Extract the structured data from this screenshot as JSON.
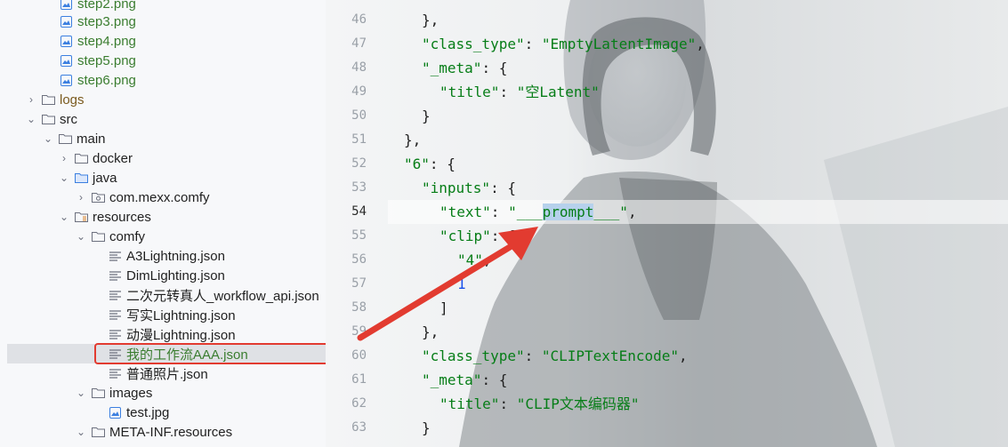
{
  "tree": {
    "rows": [
      {
        "label": "step2.png",
        "type": "image",
        "chev": "",
        "color": "green"
      },
      {
        "label": "step3.png",
        "type": "image",
        "chev": "",
        "color": "green"
      },
      {
        "label": "step4.png",
        "type": "image",
        "chev": "",
        "color": "green"
      },
      {
        "label": "step5.png",
        "type": "image",
        "chev": "",
        "color": "green"
      },
      {
        "label": "step6.png",
        "type": "image",
        "chev": "",
        "color": "green"
      },
      {
        "label": "logs",
        "type": "folder",
        "chev": "›",
        "color": "brown"
      },
      {
        "label": "src",
        "type": "folder",
        "chev": "⌄",
        "color": ""
      },
      {
        "label": "main",
        "type": "folder",
        "chev": "⌄",
        "color": ""
      },
      {
        "label": "docker",
        "type": "folder",
        "chev": "›",
        "color": ""
      },
      {
        "label": "java",
        "type": "folder-blue",
        "chev": "⌄",
        "color": ""
      },
      {
        "label": "com.mexx.comfy",
        "type": "package",
        "chev": "›",
        "color": ""
      },
      {
        "label": "resources",
        "type": "folder-res",
        "chev": "⌄",
        "color": ""
      },
      {
        "label": "comfy",
        "type": "folder",
        "chev": "⌄",
        "color": ""
      },
      {
        "label": "A3Lightning.json",
        "type": "json",
        "chev": "",
        "color": ""
      },
      {
        "label": "DimLighting.json",
        "type": "json",
        "chev": "",
        "color": ""
      },
      {
        "label": "二次元转真人_workflow_api.json",
        "type": "json",
        "chev": "",
        "color": ""
      },
      {
        "label": "写实Lightning.json",
        "type": "json",
        "chev": "",
        "color": ""
      },
      {
        "label": "动漫Lightning.json",
        "type": "json",
        "chev": "",
        "color": ""
      },
      {
        "label": "我的工作流AAA.json",
        "type": "json",
        "chev": "",
        "color": "sel"
      },
      {
        "label": "普通照片.json",
        "type": "json",
        "chev": "",
        "color": ""
      },
      {
        "label": "images",
        "type": "folder",
        "chev": "⌄",
        "color": ""
      },
      {
        "label": "test.jpg",
        "type": "image",
        "chev": "",
        "color": ""
      },
      {
        "label": "META-INF.resources",
        "type": "folder",
        "chev": "⌄",
        "color": ""
      }
    ]
  },
  "editor": {
    "lines": [
      {
        "no": "46",
        "text": "},"
      },
      {
        "no": "47",
        "text": "\"class_type\": \"EmptyLatentImage\","
      },
      {
        "no": "48",
        "text": "\"_meta\": {"
      },
      {
        "no": "49",
        "text": "\"title\": \"空Latent\""
      },
      {
        "no": "50",
        "text": "}"
      },
      {
        "no": "51",
        "text": "},"
      },
      {
        "no": "52",
        "text": "\"6\": {"
      },
      {
        "no": "53",
        "text": "\"inputs\": {"
      },
      {
        "no": "54",
        "text": "\"text\": \"___prompt___\","
      },
      {
        "no": "55",
        "text": "\"clip\": ["
      },
      {
        "no": "56",
        "text": "\"4\","
      },
      {
        "no": "57",
        "text": "1"
      },
      {
        "no": "58",
        "text": "]"
      },
      {
        "no": "59",
        "text": "},"
      },
      {
        "no": "60",
        "text": "\"class_type\": \"CLIPTextEncode\","
      },
      {
        "no": "61",
        "text": "\"_meta\": {"
      },
      {
        "no": "62",
        "text": "\"title\": \"CLIP文本编码器\""
      },
      {
        "no": "63",
        "text": "}"
      }
    ]
  },
  "colors": {
    "string": "#067d17",
    "number": "#1750eb",
    "annotation": "#e23b30",
    "highlight": "#b6d1ec"
  }
}
